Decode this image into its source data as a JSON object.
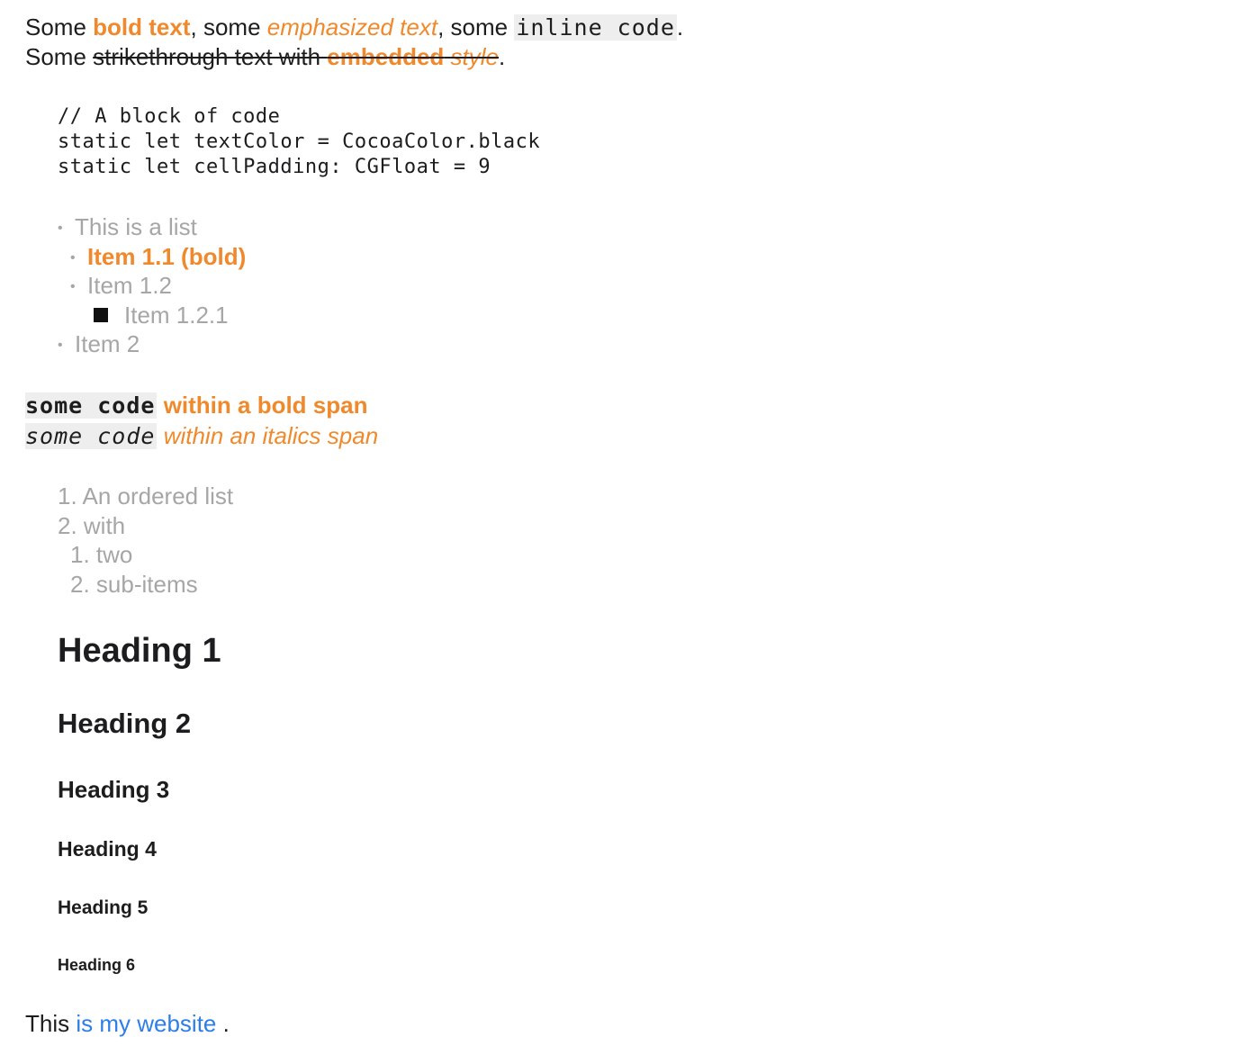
{
  "paragraph1": {
    "line1": {
      "some": "Some ",
      "bold": "bold text",
      "comma_some": ", some ",
      "emph": "emphasized text",
      "comma_some2": ", some ",
      "code": "inline code",
      "period": "."
    },
    "line2": {
      "some": "Some ",
      "strike": "strikethrough text with ",
      "strike_bold": "embedded",
      "strike_space": " ",
      "strike_italic": "style",
      "period": "."
    }
  },
  "code_block": {
    "line1": "// A block of code",
    "line2": "static let textColor = CocoaColor.black",
    "line3": "static let cellPadding: CGFloat = 9"
  },
  "unordered_list": {
    "bullet": "•",
    "item1": "This is a list",
    "item1_1": "Item 1.1 (bold)",
    "item1_2": "Item 1.2",
    "item1_2_1": "Item 1.2.1",
    "item2": "Item 2"
  },
  "code_spans": {
    "bold_code": "some code",
    "bold_text": " within a bold span",
    "italic_code": "some code",
    "italic_text": " within an italics span"
  },
  "ordered_list": {
    "item1": "1. An ordered list",
    "item2": "2. with",
    "item2_1": "1. two",
    "item2_2": "2. sub-items"
  },
  "headings": {
    "h1": "Heading 1",
    "h2": "Heading 2",
    "h3": "Heading 3",
    "h4": "Heading 4",
    "h5": "Heading 5",
    "h6": "Heading 6"
  },
  "final_paragraph": {
    "this": "This ",
    "link": "is my website",
    "period": " ."
  },
  "colors": {
    "accent": "#f0892b",
    "link": "#2d7ee8",
    "list_gray": "#a6a6a6",
    "code_bg": "#eeeeee"
  }
}
